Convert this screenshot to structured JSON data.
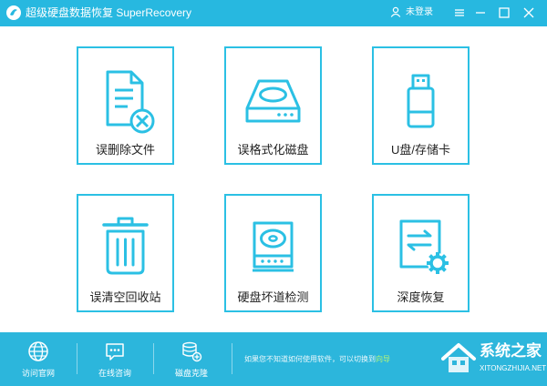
{
  "window": {
    "title": "超级硬盘数据恢复 SuperRecovery",
    "user_label": "未登录"
  },
  "tiles": [
    {
      "label": "误删除文件"
    },
    {
      "label": "误格式化磁盘"
    },
    {
      "label": "U盘/存储卡"
    },
    {
      "label": "误清空回收站"
    },
    {
      "label": "硬盘坏道检测"
    },
    {
      "label": "深度恢复"
    }
  ],
  "footer": {
    "items": [
      {
        "label": "访问官网",
        "icon": "globe-icon"
      },
      {
        "label": "在线咨询",
        "icon": "chat-icon"
      },
      {
        "label": "磁盘克隆",
        "icon": "disk-clone-icon"
      }
    ],
    "hint": "如果您不知道如何使用软件，可以切换到",
    "hint_link": "向导"
  },
  "watermark": {
    "text": "系统之家",
    "sub": "XITONGZHIJIA.NET"
  },
  "colors": {
    "accent": "#2bc0e4",
    "titlebar": "#27b8e0",
    "footer": "#2cb6dc"
  }
}
